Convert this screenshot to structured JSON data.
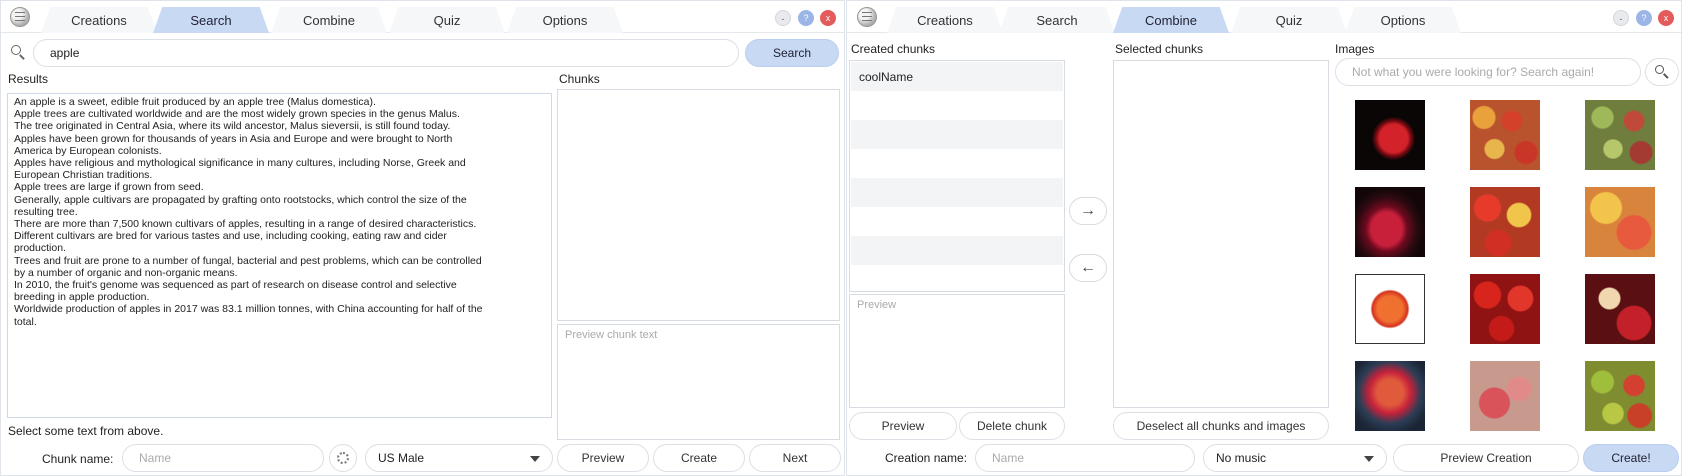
{
  "left": {
    "tabs": [
      {
        "label": "Creations",
        "active": false
      },
      {
        "label": "Search",
        "active": true
      },
      {
        "label": "Combine",
        "active": false
      },
      {
        "label": "Quiz",
        "active": false
      },
      {
        "label": "Options",
        "active": false
      }
    ],
    "window_buttons": {
      "minimize": "-",
      "help": "?",
      "close": "x"
    },
    "search": {
      "value": "apple",
      "button": "Search"
    },
    "results_label": "Results",
    "chunks_label": "Chunks",
    "results_lines": [
      "An apple is a sweet, edible fruit produced by an apple tree (Malus domestica).",
      "Apple trees are cultivated worldwide and are the most widely grown species in the genus Malus.",
      "The tree originated in Central Asia, where its wild ancestor, Malus sieversii, is still found today.",
      "Apples have been grown for thousands of years in Asia and Europe and were brought to North",
      "America by European colonists.",
      "Apples have religious and mythological significance in many cultures, including Norse, Greek and",
      "European Christian traditions.",
      "Apple trees are large if grown from seed.",
      "Generally, apple cultivars are propagated by grafting onto rootstocks, which control the size of the",
      "resulting tree.",
      "There are more than 7,500 known cultivars of apples, resulting in a range of desired characteristics.",
      "Different cultivars are bred for various tastes and use, including cooking, eating raw and cider",
      "production.",
      "Trees and fruit are prone to a number of fungal, bacterial and pest problems, which can be controlled",
      "by a number of organic and non-organic means.",
      "In 2010, the fruit's genome was sequenced as part of research on disease control and selective",
      "breeding in apple production.",
      "Worldwide production of apples in 2017 was 83.1 million tonnes, with China accounting for half of the",
      "total."
    ],
    "preview_placeholder": "Preview chunk text",
    "hint": "Select some text from above.",
    "chunk_name_label": "Chunk name:",
    "chunk_name_placeholder": "Name",
    "voice_selected": "US Male",
    "buttons": {
      "preview": "Preview",
      "create": "Create",
      "next": "Next"
    }
  },
  "right": {
    "tabs": [
      {
        "label": "Creations",
        "active": false
      },
      {
        "label": "Search",
        "active": false
      },
      {
        "label": "Combine",
        "active": true
      },
      {
        "label": "Quiz",
        "active": false
      },
      {
        "label": "Options",
        "active": false
      }
    ],
    "window_buttons": {
      "minimize": "-",
      "help": "?",
      "close": "x"
    },
    "created_chunks_label": "Created chunks",
    "selected_chunks_label": "Selected chunks",
    "images_label": "Images",
    "created_chunks": [
      "coolName"
    ],
    "preview_placeholder": "Preview",
    "image_search_placeholder": "Not what you were looking for? Search again!",
    "arrow_right": "→",
    "arrow_left": "←",
    "buttons": {
      "preview": "Preview",
      "delete_chunk": "Delete chunk",
      "deselect_all": "Deselect all chunks and images",
      "preview_creation": "Preview Creation",
      "create": "Create!"
    },
    "creation_name_label": "Creation name:",
    "creation_name_placeholder": "Name",
    "music_selected": "No music"
  },
  "colors": {
    "accent": "#c8d9f3",
    "close": "#e45b5b",
    "help": "#9bb5e6"
  }
}
